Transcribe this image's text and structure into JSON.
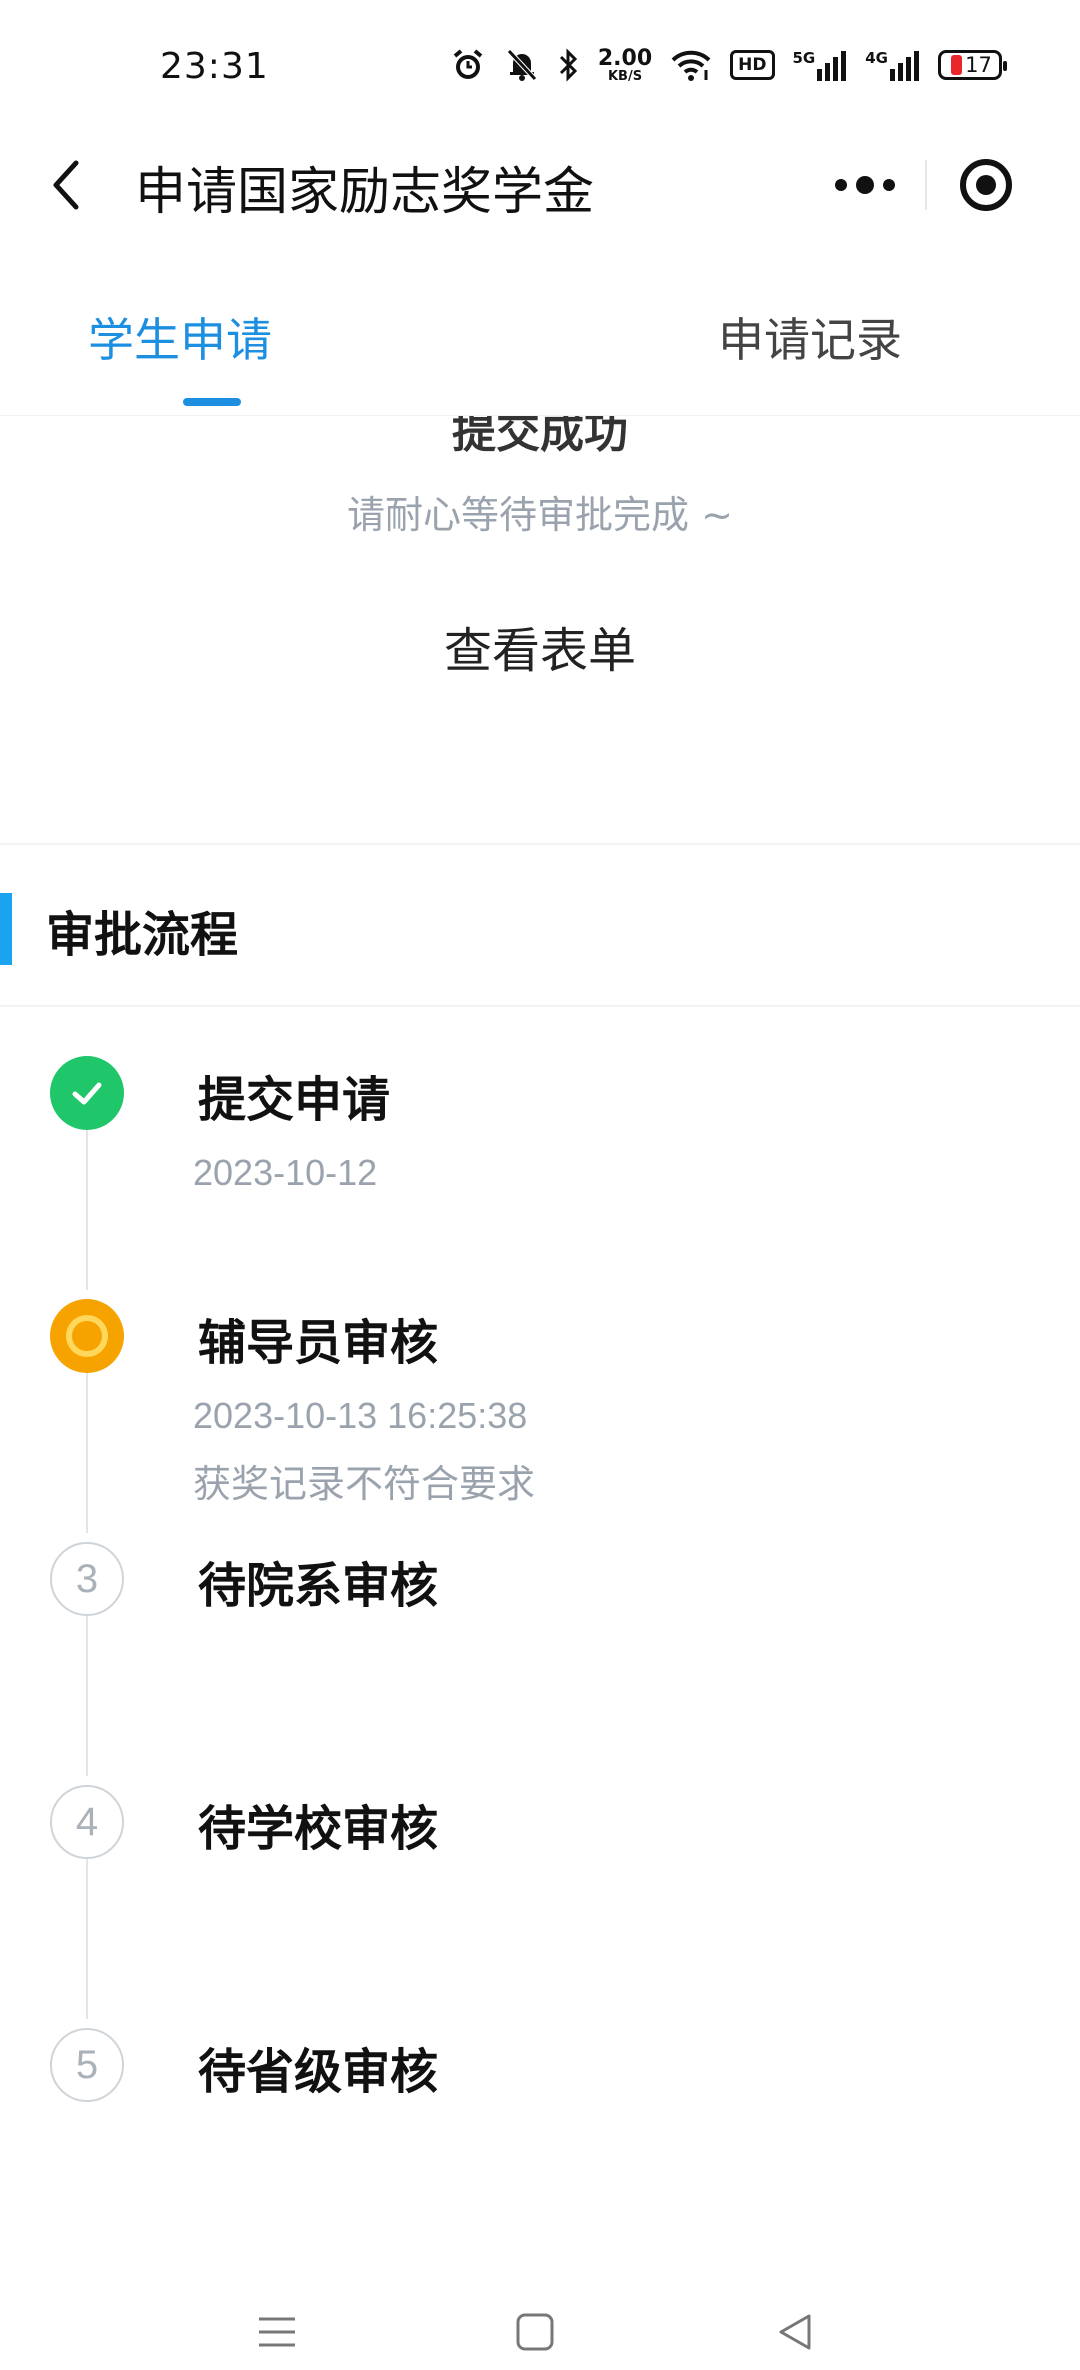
{
  "status_bar": {
    "time": "23:31",
    "net_speed_value": "2.00",
    "net_speed_unit": "KB/S",
    "hd_label": "HD",
    "sim1_label": "5G",
    "sim2_label": "4G",
    "battery_level": "17",
    "icons": [
      "alarm-icon",
      "mute-bell-icon",
      "bluetooth-icon",
      "wifi-icon",
      "hd-icon",
      "signal-5g-icon",
      "signal-4g-icon",
      "battery-icon"
    ]
  },
  "nav": {
    "title": "申请国家励志奖学金",
    "back_icon": "chevron-left-icon",
    "more_icon": "more-dots-icon",
    "close_icon": "target-circle-icon"
  },
  "tabs": [
    {
      "label": "学生申请",
      "active": true
    },
    {
      "label": "申请记录",
      "active": false
    }
  ],
  "submitted": {
    "title": "提交成功",
    "hint": "请耐心等待审批完成 ~",
    "view_form": "查看表单"
  },
  "process": {
    "title": "审批流程",
    "accent_color": "#1aa3ee",
    "steps": [
      {
        "status": "done",
        "title": "提交申请",
        "time": "2023-10-12",
        "note": ""
      },
      {
        "status": "current",
        "title": "辅导员审核",
        "time": "2023-10-13 16:25:38",
        "note": "获奖记录不符合要求"
      },
      {
        "status": "todo",
        "number": "3",
        "title": "待院系审核",
        "time": "",
        "note": ""
      },
      {
        "status": "todo",
        "number": "4",
        "title": "待学校审核",
        "time": "",
        "note": ""
      },
      {
        "status": "todo",
        "number": "5",
        "title": "待省级审核",
        "time": "",
        "note": ""
      }
    ]
  },
  "colors": {
    "primary": "#1d8fe1",
    "done": "#20c76a",
    "current": "#f6a300",
    "muted_text": "#9aa3ad"
  },
  "system_nav": {
    "icons": [
      "menu-icon",
      "home-square-icon",
      "back-triangle-icon"
    ]
  }
}
